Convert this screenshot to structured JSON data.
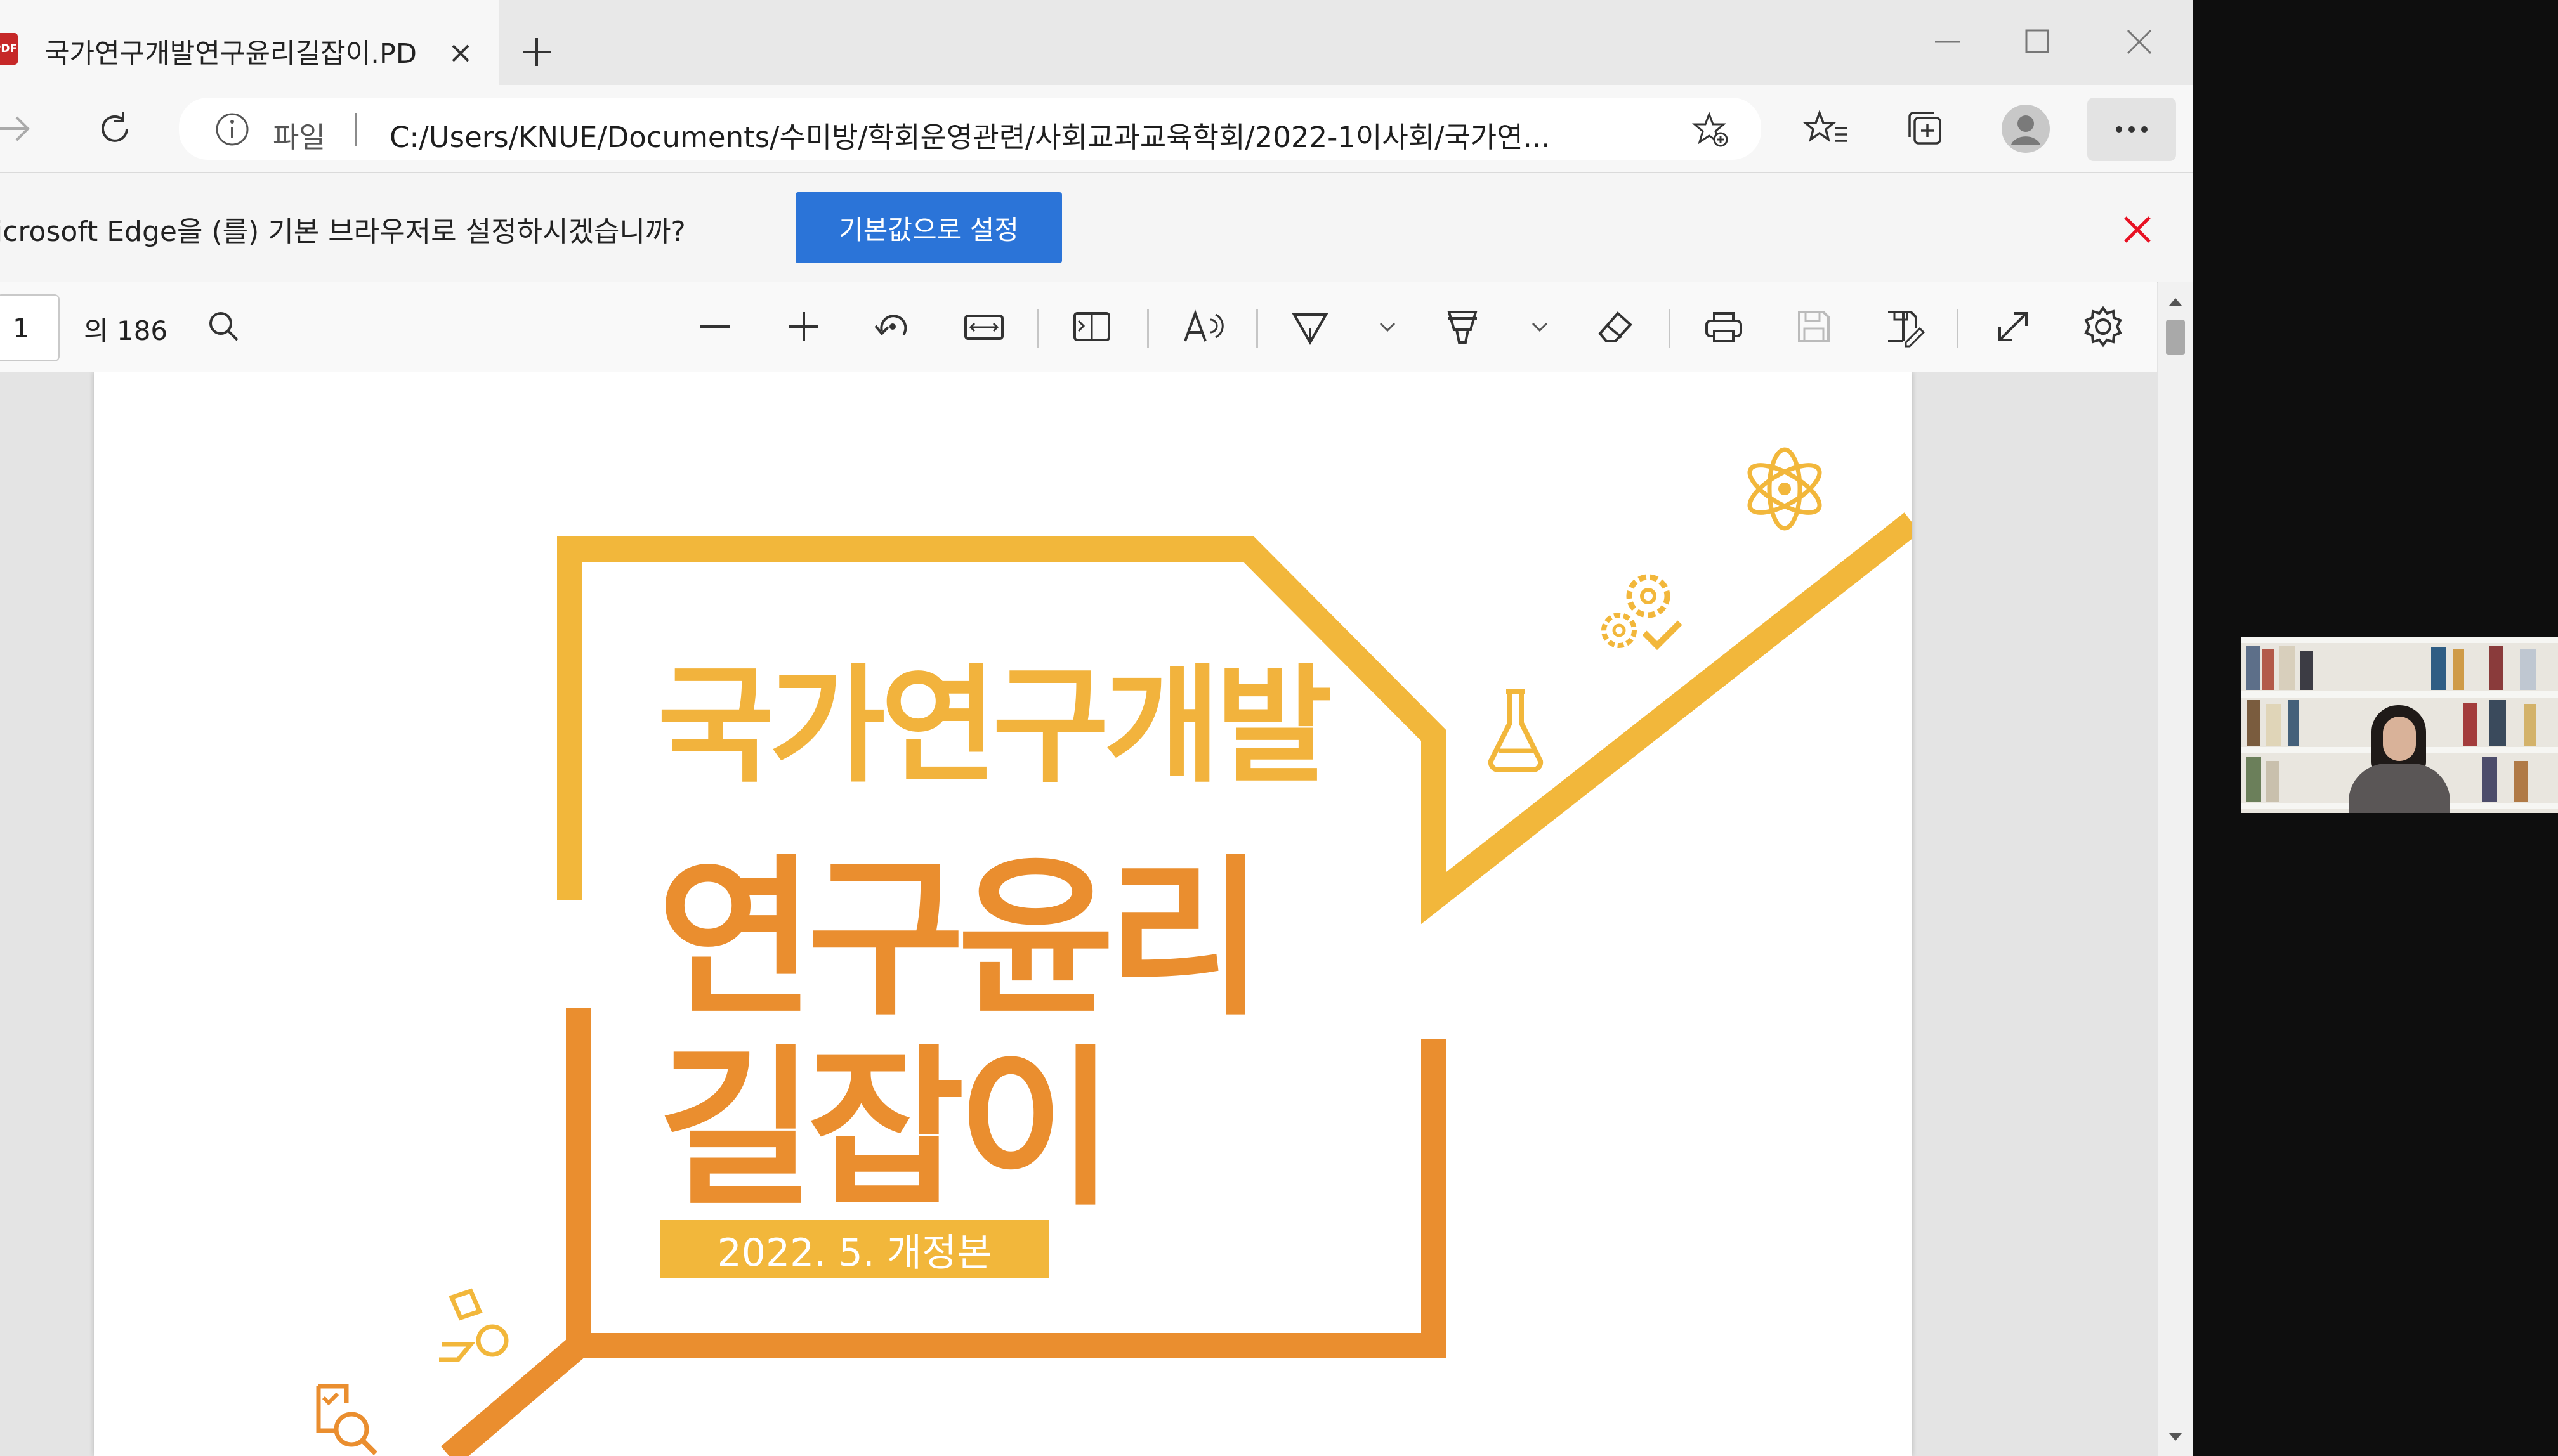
{
  "browser": {
    "tab": {
      "title": "국가연구개발연구윤리길잡이.PD",
      "favicon": "pdf-icon"
    },
    "window_controls": [
      "minimize-icon",
      "maximize-icon",
      "close-icon"
    ],
    "address": {
      "info_label": "파일",
      "url": "C:/Users/KNUE/Documents/수미방/학회운영관련/사회교과교육학회/2022-1이사회/국가연..."
    },
    "infobar": {
      "message": "icrosoft Edge을 (를) 기본 브라우저로 설정하시겠습니까?",
      "button_label": "기본값으로 설정",
      "accent": "#2b74d8",
      "close_color": "#e81123"
    }
  },
  "pdf_toolbar": {
    "page_number": "1",
    "page_count": "의 186",
    "tools": [
      "search-icon",
      "zoom-out-icon",
      "zoom-in-icon",
      "rotate-icon",
      "fit-width-icon",
      "page-view-icon",
      "read-aloud-icon",
      "draw-icon",
      "highlight-icon",
      "erase-icon",
      "print-icon",
      "save-icon",
      "save-as-icon",
      "fullscreen-icon",
      "settings-icon"
    ]
  },
  "document": {
    "heading": "국가연구개발",
    "title_line1": "연구윤리",
    "title_line2": "길잡이",
    "edition": "2022. 5. 개정본",
    "colors": {
      "yellow": "#f2b73b",
      "orange": "#ea8e2f"
    }
  },
  "video": {
    "participant": "webcam-feed"
  }
}
